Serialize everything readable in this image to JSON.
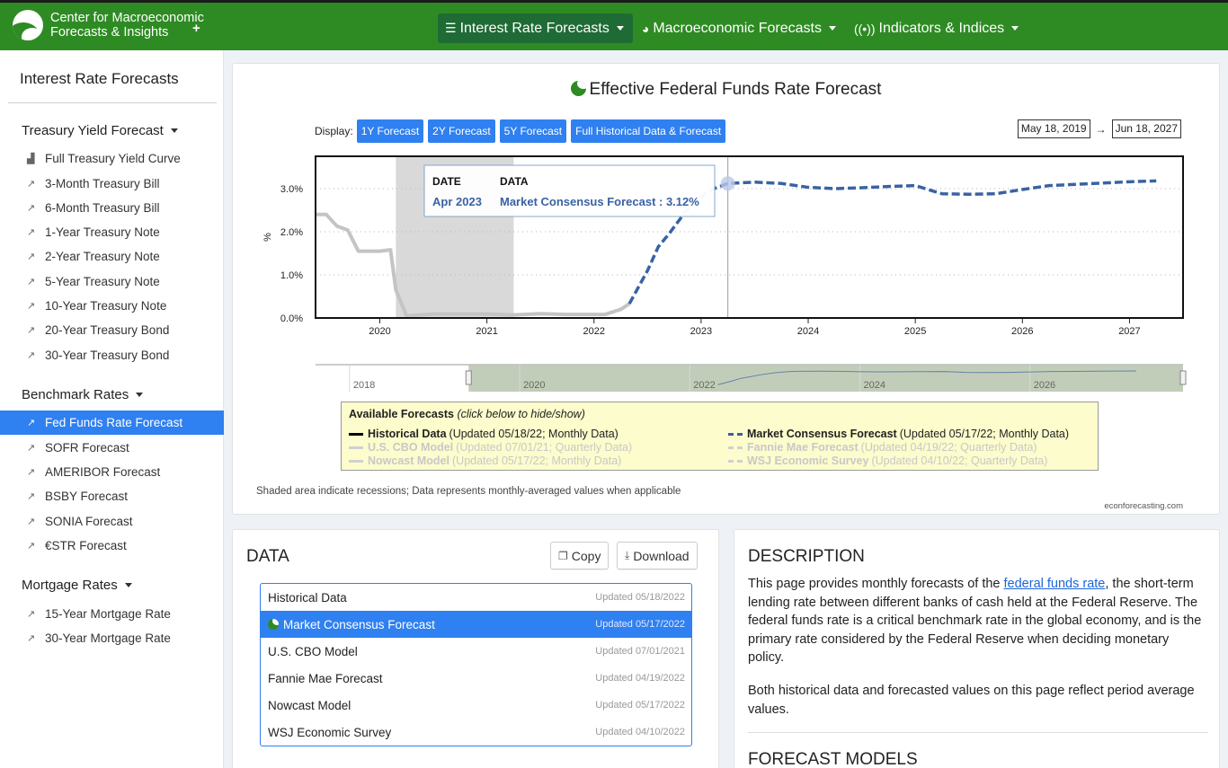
{
  "brand": {
    "line1": "Center for Macroeconomic",
    "line2": "Forecasts & Insights",
    "plus": "+"
  },
  "nav": [
    {
      "label": "Interest Rate Forecasts",
      "icon": "☰",
      "active": true
    },
    {
      "label": "Macroeconomic Forecasts",
      "icon": "◕",
      "active": false
    },
    {
      "label": "Indicators & Indices",
      "icon": "((•))",
      "active": false
    }
  ],
  "sidebar": {
    "title": "Interest Rate Forecasts",
    "groups": [
      {
        "label": "Treasury Yield Forecast",
        "items": [
          {
            "label": "Full Treasury Yield Curve",
            "icon": "▟"
          },
          {
            "label": "3-Month Treasury Bill",
            "icon": "↗"
          },
          {
            "label": "6-Month Treasury Bill",
            "icon": "↗"
          },
          {
            "label": "1-Year Treasury Note",
            "icon": "↗"
          },
          {
            "label": "2-Year Treasury Note",
            "icon": "↗"
          },
          {
            "label": "5-Year Treasury Note",
            "icon": "↗"
          },
          {
            "label": "10-Year Treasury Note",
            "icon": "↗"
          },
          {
            "label": "20-Year Treasury Bond",
            "icon": "↗"
          },
          {
            "label": "30-Year Treasury Bond",
            "icon": "↗"
          }
        ]
      },
      {
        "label": "Benchmark Rates",
        "items": [
          {
            "label": "Fed Funds Rate Forecast",
            "icon": "↗",
            "active": true
          },
          {
            "label": "SOFR Forecast",
            "icon": "↗"
          },
          {
            "label": "AMERIBOR Forecast",
            "icon": "↗"
          },
          {
            "label": "BSBY Forecast",
            "icon": "↗"
          },
          {
            "label": "SONIA Forecast",
            "icon": "↗"
          },
          {
            "label": "€STR Forecast",
            "icon": "↗"
          }
        ]
      },
      {
        "label": "Mortgage Rates",
        "items": [
          {
            "label": "15-Year Mortgage Rate",
            "icon": "↗"
          },
          {
            "label": "30-Year Mortgage Rate",
            "icon": "↗"
          }
        ]
      }
    ]
  },
  "chart_card": {
    "title": "Effective Federal Funds Rate Forecast",
    "display_label": "Display:",
    "buttons": [
      "1Y Forecast",
      "2Y Forecast",
      "5Y Forecast",
      "Full Historical Data & Forecast"
    ],
    "date_from": "May 18, 2019",
    "date_arrow": "→",
    "date_to": "Jun 18, 2027",
    "legend_title": "Available Forecasts",
    "legend_hint": "(click below to hide/show)",
    "legend": [
      {
        "name": "Historical Data",
        "info": "(Updated 05/18/22; Monthly Data)",
        "active": true,
        "dashed": false
      },
      {
        "name": "U.S. CBO Model",
        "info": "(Updated 07/01/21; Quarterly Data)",
        "active": false,
        "dashed": false
      },
      {
        "name": "Nowcast Model",
        "info": "(Updated 05/17/22; Monthly Data)",
        "active": false,
        "dashed": false
      },
      {
        "name": "Market Consensus Forecast",
        "info": "(Updated 05/17/22; Monthly Data)",
        "active": true,
        "dashed": true
      },
      {
        "name": "Fannie Mae Forecast",
        "info": "(Updated 04/19/22; Quarterly Data)",
        "active": false,
        "dashed": true
      },
      {
        "name": "WSJ Economic Survey",
        "info": "(Updated 04/10/22; Quarterly Data)",
        "active": false,
        "dashed": true
      }
    ],
    "note": "Shaded area indicate recessions; Data represents monthly-averaged values when applicable",
    "credit": "econforecasting.com"
  },
  "chart_data": {
    "type": "line",
    "title": "Effective Federal Funds Rate Forecast",
    "ylabel": "%",
    "xlim": [
      2019.4,
      2027.5
    ],
    "ylim": [
      0,
      3.75
    ],
    "y_ticks": [
      "0.0%",
      "1.0%",
      "2.0%",
      "3.0%"
    ],
    "x_ticks": [
      "2020",
      "2021",
      "2022",
      "2023",
      "2024",
      "2025",
      "2026",
      "2027"
    ],
    "grid": "horizontal dotted",
    "recession_shading": [
      2020.15,
      2021.25
    ],
    "series": [
      {
        "name": "Historical Data",
        "color": "#c4c4c4",
        "x": [
          2019.4,
          2019.5,
          2019.6,
          2019.7,
          2019.8,
          2019.9,
          2020.0,
          2020.1,
          2020.15,
          2020.25,
          2020.5,
          2020.75,
          2021.0,
          2021.25,
          2021.5,
          2021.75,
          2022.0,
          2022.1,
          2022.25,
          2022.33
        ],
        "y": [
          2.4,
          2.4,
          2.13,
          2.04,
          1.55,
          1.55,
          1.55,
          1.58,
          0.65,
          0.05,
          0.09,
          0.09,
          0.09,
          0.07,
          0.1,
          0.08,
          0.08,
          0.08,
          0.2,
          0.33
        ]
      },
      {
        "name": "Market Consensus Forecast",
        "color": "#3a62a4",
        "x": [
          2022.33,
          2022.5,
          2022.6,
          2022.7,
          2022.85,
          2023.0,
          2023.1,
          2023.25,
          2023.5,
          2023.75,
          2024.0,
          2024.25,
          2024.5,
          2024.75,
          2025.0,
          2025.25,
          2025.5,
          2025.75,
          2026.0,
          2026.25,
          2026.5,
          2026.75,
          2027.0,
          2027.25
        ],
        "y": [
          0.33,
          1.1,
          1.65,
          1.95,
          2.45,
          2.82,
          2.98,
          3.12,
          3.15,
          3.12,
          3.03,
          3.0,
          3.02,
          3.05,
          3.07,
          2.88,
          2.87,
          2.88,
          2.98,
          3.07,
          3.1,
          3.13,
          3.16,
          3.18
        ]
      }
    ],
    "tooltip": {
      "header_date": "DATE",
      "header_data": "DATA",
      "date": "Apr 2023",
      "series": "Market Consensus Forecast",
      "value": "3.12%"
    },
    "navigator": {
      "x_ticks": [
        "2018",
        "2020",
        "2022",
        "2024",
        "2026"
      ],
      "selected_range": [
        2019.4,
        2027.5
      ]
    }
  },
  "data_card": {
    "title": "DATA",
    "copy_label": "Copy",
    "download_label": "Download",
    "rows": [
      {
        "name": "Historical Data",
        "updated": "Updated 05/18/2022",
        "active": false
      },
      {
        "name": "Market Consensus Forecast",
        "updated": "Updated 05/17/2022",
        "active": true
      },
      {
        "name": "U.S. CBO Model",
        "updated": "Updated 07/01/2021",
        "active": false
      },
      {
        "name": "Fannie Mae Forecast",
        "updated": "Updated 04/19/2022",
        "active": false
      },
      {
        "name": "Nowcast Model",
        "updated": "Updated 05/17/2022",
        "active": false
      },
      {
        "name": "WSJ Economic Survey",
        "updated": "Updated 04/10/2022",
        "active": false
      }
    ]
  },
  "description": {
    "title": "DESCRIPTION",
    "p1_pre": "This page provides monthly forecasts of the ",
    "p1_link": "federal funds rate",
    "p1_post": ", the short-term lending rate between different banks of cash held at the Federal Reserve. The federal funds rate is a critical benchmark rate in the global economy, and is the primary rate considered by the Federal Reserve when deciding monetary policy.",
    "p2": "Both historical data and forecasted values on this page reflect period average values.",
    "subtitle": "FORECAST MODELS"
  },
  "colors": {
    "brand_green": "#2e8b23",
    "accent_blue": "#2f80f0",
    "forecast_line": "#3a62a4",
    "historical_line": "#c4c4c4",
    "legend_bg": "#fdfccc"
  }
}
